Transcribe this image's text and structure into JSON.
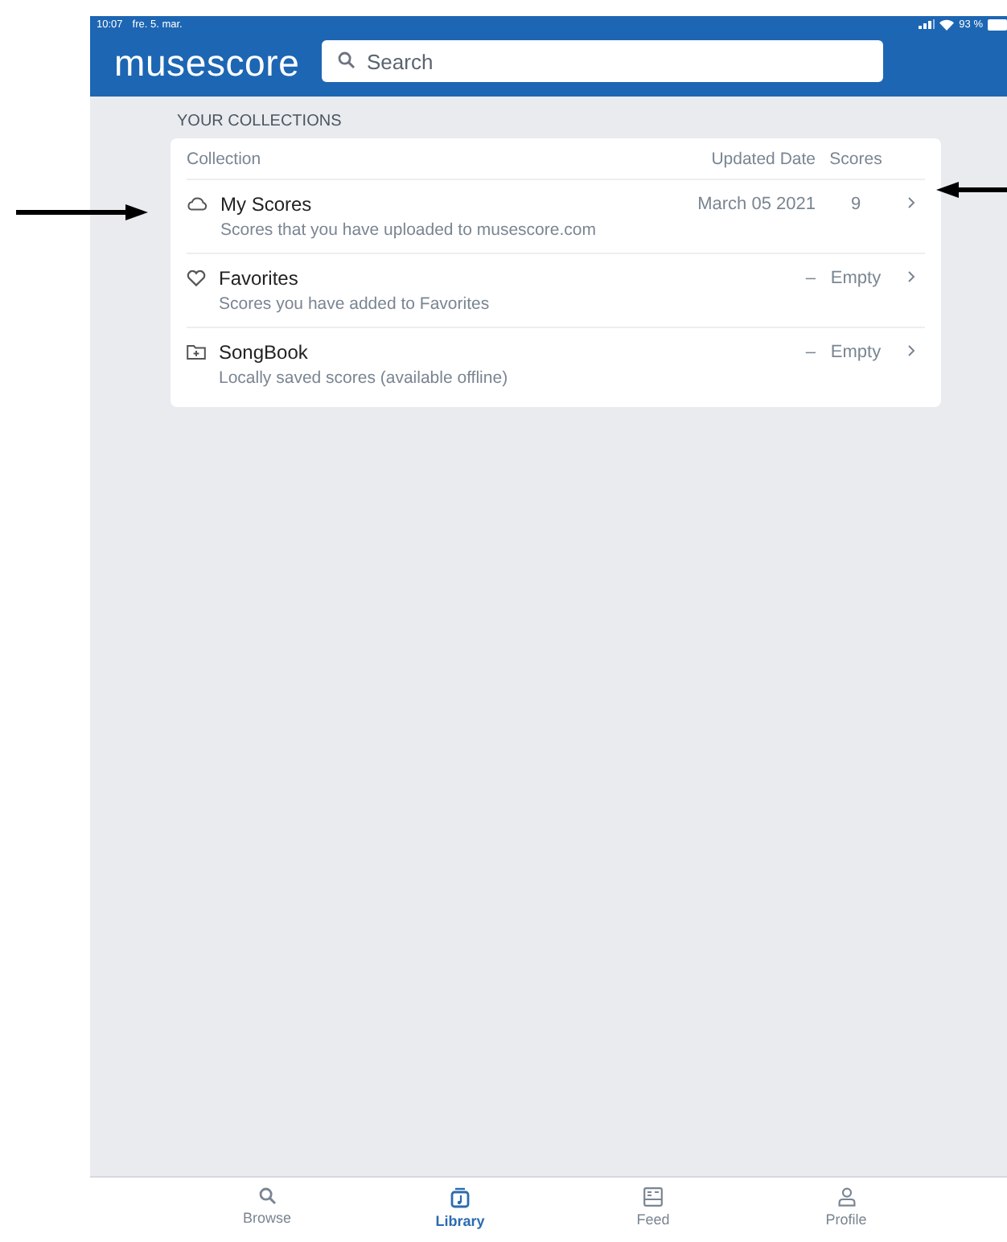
{
  "status_bar": {
    "time": "10:07",
    "date": "fre. 5. mar.",
    "battery": "93 %"
  },
  "header": {
    "logo": "musescore",
    "search": {
      "placeholder": "Search"
    }
  },
  "section_title": "YOUR COLLECTIONS",
  "table": {
    "columns": [
      "Collection",
      "Updated Date",
      "Scores"
    ],
    "rows": [
      {
        "kind": "cloud",
        "name": "My Scores",
        "description": "Scores that you have uploaded to musescore.com",
        "updated": "March 05 2021",
        "scores": "9"
      },
      {
        "kind": "heart",
        "name": "Favorites",
        "description": "Scores you have added to Favorites",
        "updated": "–",
        "scores": "Empty"
      },
      {
        "kind": "folder",
        "name": "SongBook",
        "description": "Locally saved scores (available offline)",
        "updated": "–",
        "scores": "Empty"
      }
    ]
  },
  "tabs": [
    {
      "kind": "search",
      "label": "Browse",
      "selected": false
    },
    {
      "kind": "library",
      "label": "Library",
      "selected": true
    },
    {
      "kind": "feed",
      "label": "Feed",
      "selected": false
    },
    {
      "kind": "profile",
      "label": "Profile",
      "selected": false
    }
  ]
}
